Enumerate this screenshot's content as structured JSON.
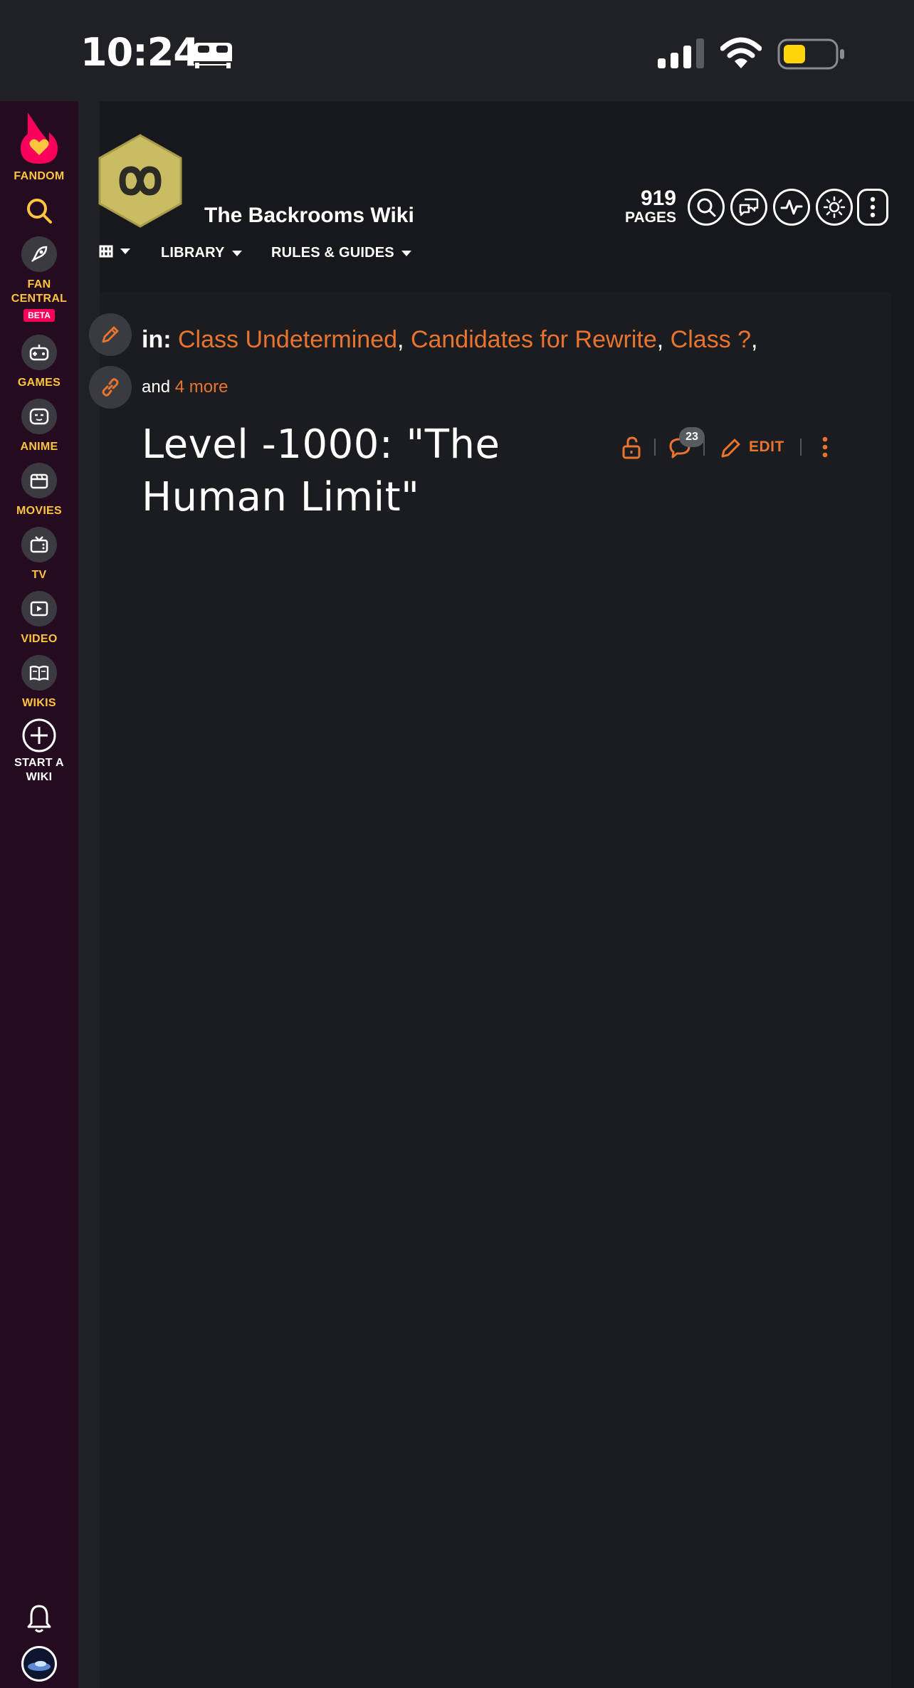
{
  "status_bar": {
    "time": "10:24"
  },
  "sidebar": {
    "fandom_label": "FANDOM",
    "items": [
      {
        "label": "FAN CENTRAL",
        "badge": "BETA",
        "icon": "rocket-icon"
      },
      {
        "label": "GAMES",
        "icon": "gamepad-icon"
      },
      {
        "label": "ANIME",
        "icon": "anime-face-icon"
      },
      {
        "label": "MOVIES",
        "icon": "clapperboard-icon"
      },
      {
        "label": "TV",
        "icon": "tv-icon"
      },
      {
        "label": "VIDEO",
        "icon": "play-icon"
      },
      {
        "label": "WIKIS",
        "icon": "book-icon"
      }
    ],
    "start_wiki_label": "START A WIKI"
  },
  "header": {
    "wiki_name": "The Backrooms Wiki",
    "pages_count": "919",
    "pages_label": "PAGES",
    "tools": [
      "search-icon",
      "discussions-icon",
      "activity-icon",
      "theme-toggle-icon",
      "more-icon"
    ]
  },
  "nav": {
    "library": "LIBRARY",
    "rules": "RULES & GUIDES"
  },
  "categories": {
    "in_label": "in:",
    "links": [
      "Class Undetermined",
      "Candidates for Rewrite",
      "Class ?"
    ],
    "and_label": "and",
    "more_label": "4 more"
  },
  "article": {
    "title": "Level -1000: \"The Human Limit\"",
    "comment_count": "23",
    "edit_label": "EDIT"
  },
  "colors": {
    "accent": "#e8742f",
    "sidebar_bg": "#240b20",
    "sidebar_label": "#fdc43f",
    "fandom_pink": "#fa005a",
    "background": "#17181b"
  }
}
